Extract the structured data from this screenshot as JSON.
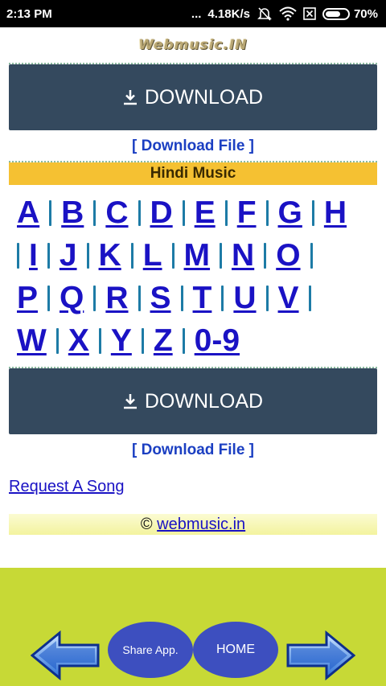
{
  "status": {
    "time": "2:13 PM",
    "dots": "...",
    "speed": "4.18K/s",
    "battery": "70%",
    "battery_level": 0.7
  },
  "logo": "Webmusic.IN",
  "download": {
    "label": "DOWNLOAD",
    "file_link": "[ Download File ]"
  },
  "section_title": "Hindi Music",
  "alphabet_rows": [
    [
      "A",
      "B",
      "C",
      "D",
      "E",
      "F",
      "G",
      "H"
    ],
    [
      "I",
      "J",
      "K",
      "L",
      "M",
      "N",
      "O"
    ],
    [
      "P",
      "Q",
      "R",
      "S",
      "T",
      "U",
      "V"
    ],
    [
      "W",
      "X",
      "Y",
      "Z",
      "0-9"
    ]
  ],
  "request_link": "Request A Song",
  "copyright": {
    "symbol": "©",
    "link": "webmusic.in"
  },
  "bottom_nav": {
    "share": "Share App.",
    "home": "HOME"
  },
  "colors": {
    "download_bg": "#34495e",
    "section_bg": "#f5c132",
    "nav_bg": "#c7d936",
    "oval": "#3d4fbf",
    "link": "#1a12c4"
  }
}
